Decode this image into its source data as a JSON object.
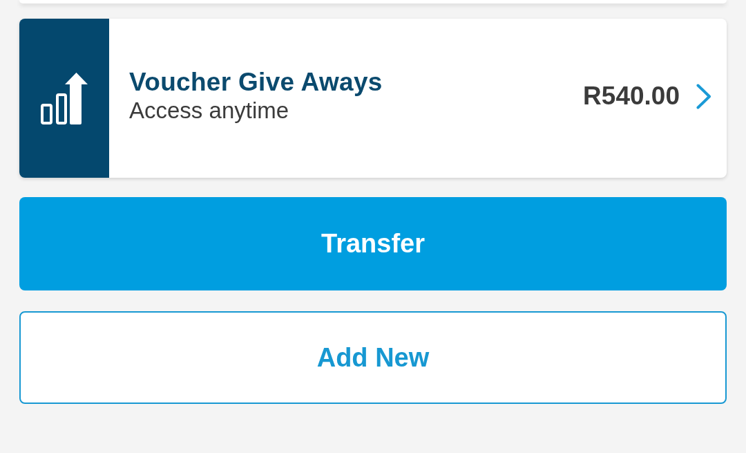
{
  "account": {
    "title": "Voucher Give Aways",
    "subtitle": "Access anytime",
    "amount": "R540.00"
  },
  "buttons": [
    {
      "label": "Transfer",
      "kind": "primary"
    },
    {
      "label": "Add New",
      "kind": "outline"
    }
  ]
}
